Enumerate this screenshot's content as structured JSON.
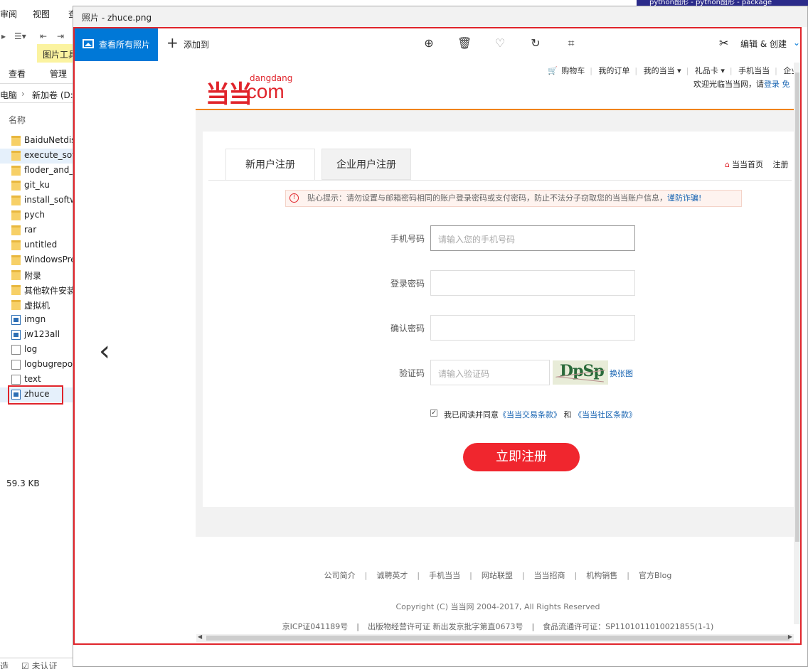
{
  "explorer": {
    "menu": [
      "审阅",
      "视图"
    ],
    "menu_extra": "查",
    "picture_tools_tab": "图片工具",
    "ribbon_tabs": [
      "查看",
      "管理"
    ],
    "address": [
      "电脑",
      "新加卷 (D:"
    ],
    "column_header": "名称",
    "files": [
      {
        "name": "BaiduNetdis",
        "type": "folder"
      },
      {
        "name": "execute_sof",
        "type": "folder"
      },
      {
        "name": "floder_and_",
        "type": "folder"
      },
      {
        "name": "git_ku",
        "type": "folder"
      },
      {
        "name": "install_softw",
        "type": "folder"
      },
      {
        "name": "pych",
        "type": "folder"
      },
      {
        "name": "rar",
        "type": "folder"
      },
      {
        "name": "untitled",
        "type": "folder"
      },
      {
        "name": "WindowsPre",
        "type": "folder"
      },
      {
        "name": "附录",
        "type": "folder"
      },
      {
        "name": "其他软件安装",
        "type": "folder"
      },
      {
        "name": "虚拟机",
        "type": "folder"
      },
      {
        "name": "imgn",
        "type": "image"
      },
      {
        "name": "jw123all",
        "type": "image"
      },
      {
        "name": "log",
        "type": "text"
      },
      {
        "name": "logbugrepo",
        "type": "text"
      },
      {
        "name": "text",
        "type": "text"
      },
      {
        "name": "zhuce",
        "type": "image"
      }
    ],
    "size": "59.3 KB",
    "status": [
      "造",
      "☑ 未认证"
    ]
  },
  "background_top_right": "python图形 - python图形 - package",
  "photos": {
    "title": "照片 - zhuce.png",
    "view_all": "查看所有照片",
    "add_to": "添加到",
    "edit_create": "编辑 & 创建"
  },
  "dangdang": {
    "logo_small": "dangdang",
    "logo_com": ".com",
    "top_links": [
      "购物车",
      "我的订单",
      "我的当当 ▾",
      "礼品卡 ▾",
      "手机当当",
      "企业销售"
    ],
    "welcome": "欢迎光临当当网，请",
    "login": "登录",
    "free_reg": "免",
    "tab_new": "新用户注册",
    "tab_enterprise": "企业用户注册",
    "home_link": "当当首页",
    "register_link": "注册",
    "notice": "贴心提示：请勿设置与邮箱密码相同的账户登录密码或支付密码，防止不法分子窃取您的当当账户信息，",
    "notice_link": "谨防诈骗!",
    "fields": {
      "phone_label": "手机号码",
      "phone_placeholder": "请输入您的手机号码",
      "pwd_label": "登录密码",
      "confirm_label": "确认密码",
      "captcha_label": "验证码",
      "captcha_placeholder": "请输入验证码",
      "captcha_text": "DpSp",
      "change_img": "换张图"
    },
    "agree_prefix": "我已阅读并同意",
    "agree_terms": "《当当交易条款》",
    "agree_and": "和",
    "agree_community": "《当当社区条款》",
    "register_button": "立即注册",
    "footer_links": [
      "公司简介",
      "诚聘英才",
      "手机当当",
      "网站联盟",
      "当当招商",
      "机构销售",
      "官方Blog"
    ],
    "copyright": "Copyright (C) 当当网 2004-2017, All Rights Reserved",
    "icp": [
      "京ICP证041189号",
      "出版物经营许可证 新出发京批字第直0673号",
      "食品流通许可证：SP1101011010021855(1-1)"
    ]
  }
}
